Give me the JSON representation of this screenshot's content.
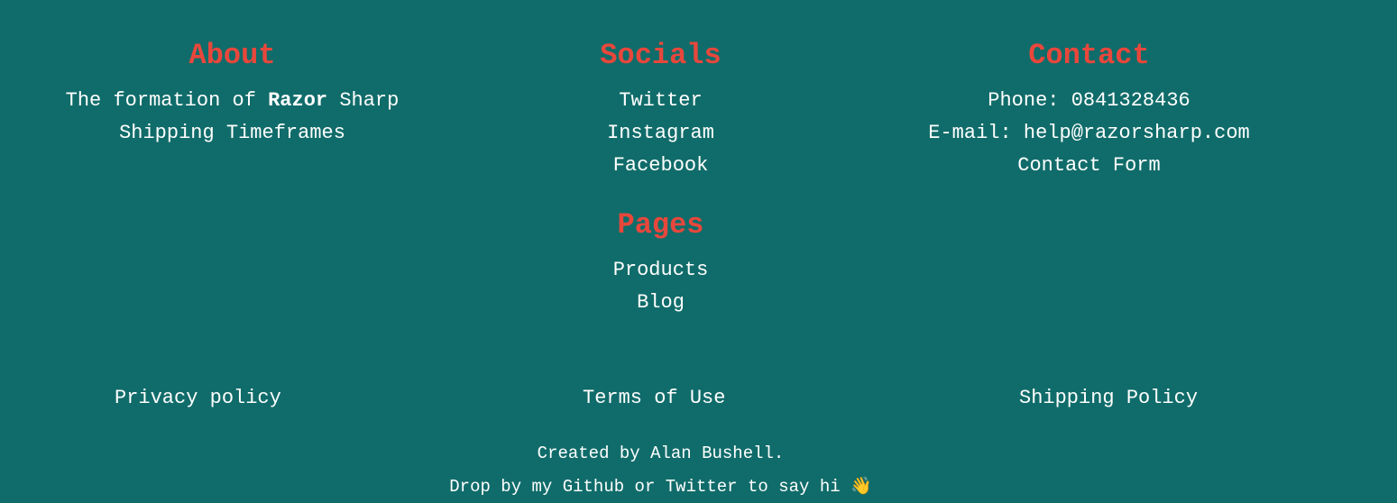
{
  "about": {
    "heading": "About",
    "formation_prefix": "The formation of",
    "formation_bold": "Razor",
    "formation_suffix": "Sharp",
    "shipping_timeframes": "Shipping Timeframes"
  },
  "socials": {
    "heading": "Socials",
    "items": [
      "Twitter",
      "Instagram",
      "Facebook"
    ]
  },
  "contact": {
    "heading": "Contact",
    "phone": "Phone: 0841328436",
    "email": "E-mail: help@razorsharp.com",
    "form": "Contact Form"
  },
  "pages": {
    "heading": "Pages",
    "items": [
      "Products",
      "Blog"
    ]
  },
  "policies": {
    "privacy": "Privacy policy",
    "terms": "Terms of Use",
    "shipping": "Shipping Policy"
  },
  "credits": {
    "line1": "Created by Alan Bushell.",
    "line2_prefix": "Drop by my",
    "github": "Github",
    "or": "or",
    "twitter": "Twitter",
    "line2_suffix": "to say hi",
    "emoji": "👋",
    "emoji_icon": "waving-hand-icon"
  },
  "colors": {
    "background": "#106c6a",
    "heading": "#e8473c",
    "text": "#ffffff"
  }
}
